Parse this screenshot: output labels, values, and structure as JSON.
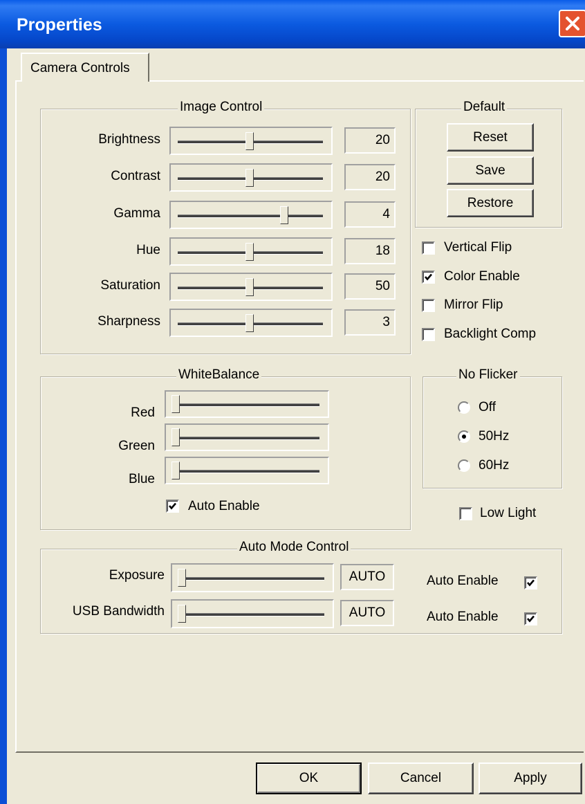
{
  "window": {
    "title": "Properties"
  },
  "tabs": [
    {
      "label": "Camera Controls"
    }
  ],
  "image_control": {
    "title": "Image Control",
    "rows": [
      {
        "label": "Brightness",
        "value": "20",
        "level": 0.5
      },
      {
        "label": "Contrast",
        "value": "20",
        "level": 0.5
      },
      {
        "label": "Gamma",
        "value": "4",
        "level": 0.75
      },
      {
        "label": "Hue",
        "value": "18",
        "level": 0.5
      },
      {
        "label": "Saturation",
        "value": "50",
        "level": 0.5
      },
      {
        "label": "Sharpness",
        "value": "3",
        "level": 0.5
      }
    ]
  },
  "default_group": {
    "title": "Default",
    "reset": "Reset",
    "save": "Save",
    "restore": "Restore"
  },
  "options": [
    {
      "label": "Vertical Flip",
      "checked": false
    },
    {
      "label": "Color Enable",
      "checked": true
    },
    {
      "label": "Mirror Flip",
      "checked": false
    },
    {
      "label": "Backlight Comp",
      "checked": false
    }
  ],
  "white_balance": {
    "title": "WhiteBalance",
    "rows": [
      {
        "label": "Red",
        "level": 0
      },
      {
        "label": "Green",
        "level": 0
      },
      {
        "label": "Blue",
        "level": 0
      }
    ],
    "auto_enable": {
      "label": "Auto Enable",
      "checked": true
    }
  },
  "no_flicker": {
    "title": "No Flicker",
    "options": [
      {
        "label": "Off",
        "selected": false
      },
      {
        "label": "50Hz",
        "selected": true
      },
      {
        "label": "60Hz",
        "selected": false
      }
    ]
  },
  "low_light": {
    "label": "Low Light",
    "checked": false
  },
  "auto_mode": {
    "title": "Auto Mode Control",
    "rows": [
      {
        "label": "Exposure",
        "value": "AUTO",
        "level": 0,
        "auto_label": "Auto Enable",
        "auto_checked": true
      },
      {
        "label": "USB Bandwidth",
        "value": "AUTO",
        "level": 0,
        "auto_label": "Auto Enable",
        "auto_checked": true
      }
    ]
  },
  "buttons": {
    "ok": "OK",
    "cancel": "Cancel",
    "apply": "Apply"
  }
}
